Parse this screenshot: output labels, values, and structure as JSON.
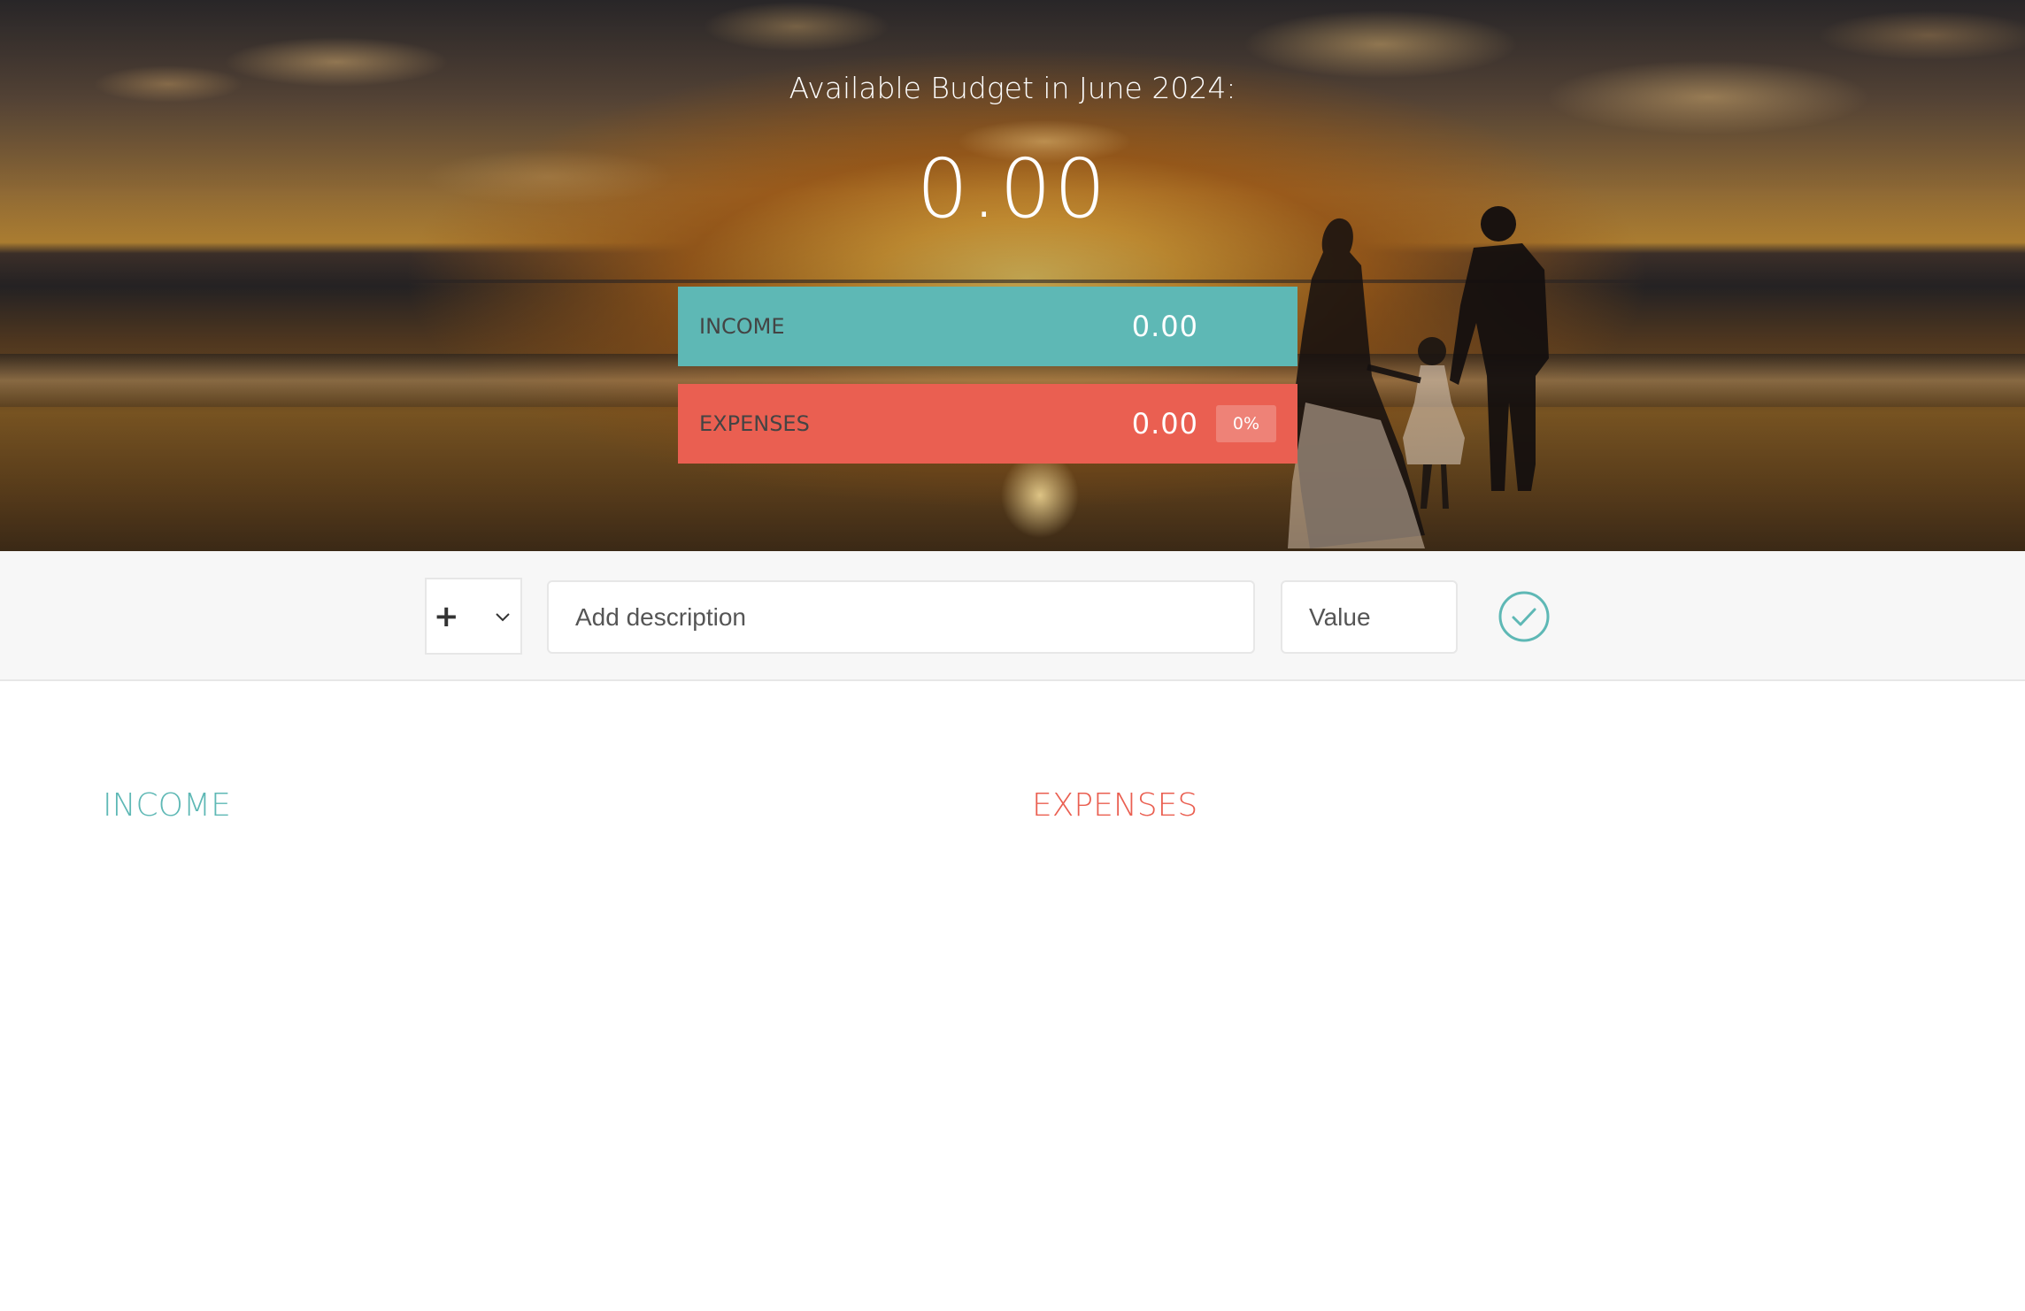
{
  "header": {
    "budget_title": "Available Budget in June 2024:",
    "budget_value": "0.00",
    "income": {
      "label": "Income",
      "value": "0.00"
    },
    "expenses": {
      "label": "Expenses",
      "value": "0.00",
      "percentage": "0%"
    }
  },
  "add_bar": {
    "type_value": "+",
    "description_placeholder": "Add description",
    "value_placeholder": "Value",
    "submit_icon": "check-circle-icon"
  },
  "lists": {
    "income_title": "Income",
    "expenses_title": "Expenses",
    "income_items": [],
    "expenses_items": []
  },
  "colors": {
    "income": "#5eb8b5",
    "expenses": "#ea5f51",
    "add_bar_bg": "#f7f7f7"
  }
}
